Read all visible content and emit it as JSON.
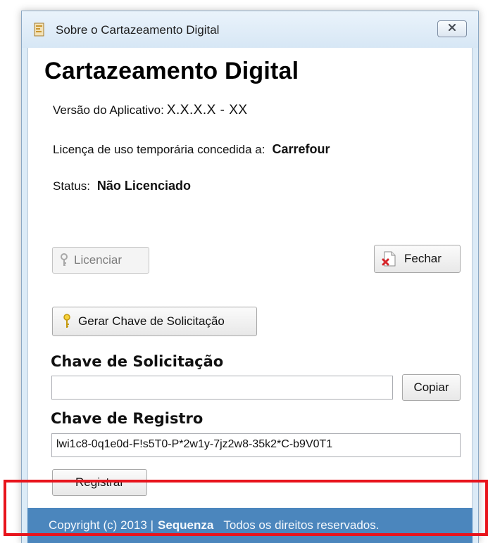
{
  "window": {
    "title": "Sobre o Cartazeamento Digital",
    "app_name": "Cartazeamento Digital"
  },
  "info": {
    "version_label": "Versão do Aplicativo:",
    "version_value": "X.X.X.X - XX",
    "license_label": "Licença de uso temporária concedida a:",
    "license_value": "Carrefour",
    "status_label": "Status:",
    "status_value": "Não Licenciado"
  },
  "buttons": {
    "licenciar": "Licenciar",
    "fechar": "Fechar",
    "gerar_chave": "Gerar Chave de Solicitação",
    "copiar": "Copiar",
    "registrar": "Registrar"
  },
  "solicitacao": {
    "label": "Chave de Solicitação",
    "value": ""
  },
  "registro": {
    "label": "Chave de Registro",
    "value": "lwi1c8-0q1e0d-F!s5T0-P*2w1y-7jz2w8-35k2*C-b9V0T1"
  },
  "footer": {
    "copyright": "Copyright (c) 2013  |",
    "brand": "Sequenza",
    "rights": "Todos os direitos reservados."
  },
  "colors": {
    "footer_bg": "#4b86bd",
    "highlight": "#e8141c"
  },
  "icons": {
    "app": "app-icon",
    "close": "close-icon",
    "key": "key-icon",
    "exit": "exit-icon"
  }
}
